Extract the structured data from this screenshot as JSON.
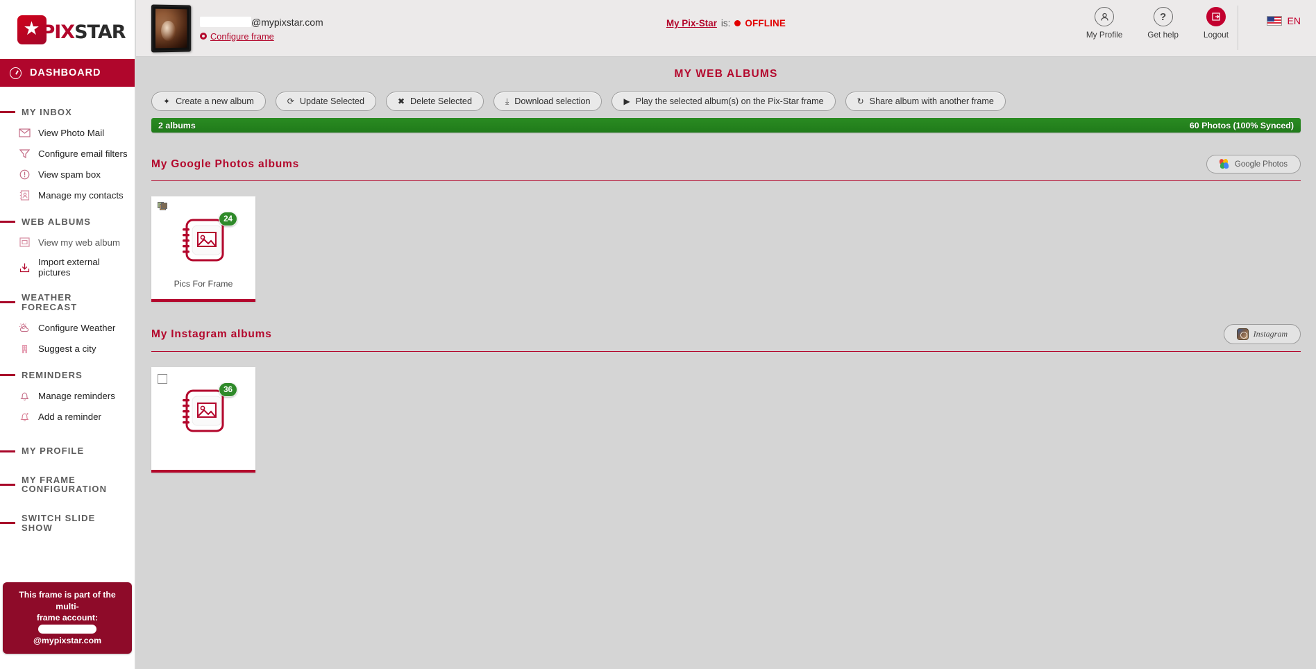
{
  "brand": {
    "name_pix": "PIX",
    "name_star": "STAR",
    "star_glyph": "★"
  },
  "sidebar": {
    "dashboard": {
      "label": "DASHBOARD",
      "icon": "dashboard-icon"
    },
    "groups": [
      {
        "title": "MY INBOX",
        "items": [
          {
            "label": "View Photo Mail",
            "icon": "envelope-icon"
          },
          {
            "label": "Configure email filters",
            "icon": "filter-icon"
          },
          {
            "label": "View spam box",
            "icon": "alert-circle-icon"
          },
          {
            "label": "Manage my contacts",
            "icon": "contacts-icon"
          }
        ]
      },
      {
        "title": "WEB ALBUMS",
        "items": [
          {
            "label": "View my web album",
            "icon": "web-album-icon"
          },
          {
            "label": "Import external pictures",
            "icon": "download-icon"
          }
        ]
      },
      {
        "title": "WEATHER FORECAST",
        "items": [
          {
            "label": "Configure Weather",
            "icon": "weather-icon"
          },
          {
            "label": "Suggest a city",
            "icon": "city-icon"
          }
        ]
      },
      {
        "title": "REMINDERS",
        "items": [
          {
            "label": "Manage reminders",
            "icon": "bell-icon"
          },
          {
            "label": "Add a reminder",
            "icon": "bell-add-icon"
          }
        ]
      },
      {
        "title": "MY PROFILE",
        "items": []
      },
      {
        "title": "MY FRAME CONFIGURATION",
        "items": []
      },
      {
        "title": "SWITCH SLIDE SHOW",
        "items": []
      }
    ],
    "multiframe_notice": {
      "line1": "This frame is part of the multi-",
      "line2": "frame account:",
      "account_suffix": "@mypixstar.com"
    }
  },
  "topbar": {
    "frame_email_suffix": "@mypixstar.com",
    "configure_frame_label": "Configure frame",
    "status_label": "My Pix-Star",
    "status_is": "is:",
    "status_value": "OFFLINE",
    "status_color": "#e20000",
    "actions": [
      {
        "label": "My Profile",
        "icon": "person-icon"
      },
      {
        "label": "Get help",
        "icon": "question-mark-icon"
      },
      {
        "label": "Logout",
        "icon": "logout-icon"
      }
    ],
    "language": {
      "label": "EN",
      "icon": "us-flag-icon"
    }
  },
  "page": {
    "title": "MY WEB ALBUMS"
  },
  "toolbar": [
    {
      "label": "Create a new album",
      "icon": "plus-icon"
    },
    {
      "label": "Update Selected",
      "icon": "refresh-icon"
    },
    {
      "label": "Delete Selected",
      "icon": "cross-icon"
    },
    {
      "label": "Download selection",
      "icon": "download-icon"
    },
    {
      "label": "Play the selected album(s) on the Pix-Star frame",
      "icon": "play-icon"
    },
    {
      "label": "Share album with another frame",
      "icon": "share-icon"
    }
  ],
  "status_bar": {
    "left": "2 albums",
    "right": "60 Photos (100% Synced)",
    "color": "#258021"
  },
  "sections": [
    {
      "title": "My Google Photos albums",
      "service_button": {
        "label": "Google Photos",
        "icon": "google-photos-icon"
      },
      "albums": [
        {
          "title": "Pics For Frame",
          "count": "24",
          "selector": "stack-icon",
          "selected": false
        }
      ]
    },
    {
      "title": "My Instagram albums",
      "service_button": {
        "label": "Instagram",
        "icon": "instagram-icon"
      },
      "albums": [
        {
          "title": "",
          "count": "36",
          "selector": "checkbox",
          "selected": false
        }
      ]
    }
  ]
}
